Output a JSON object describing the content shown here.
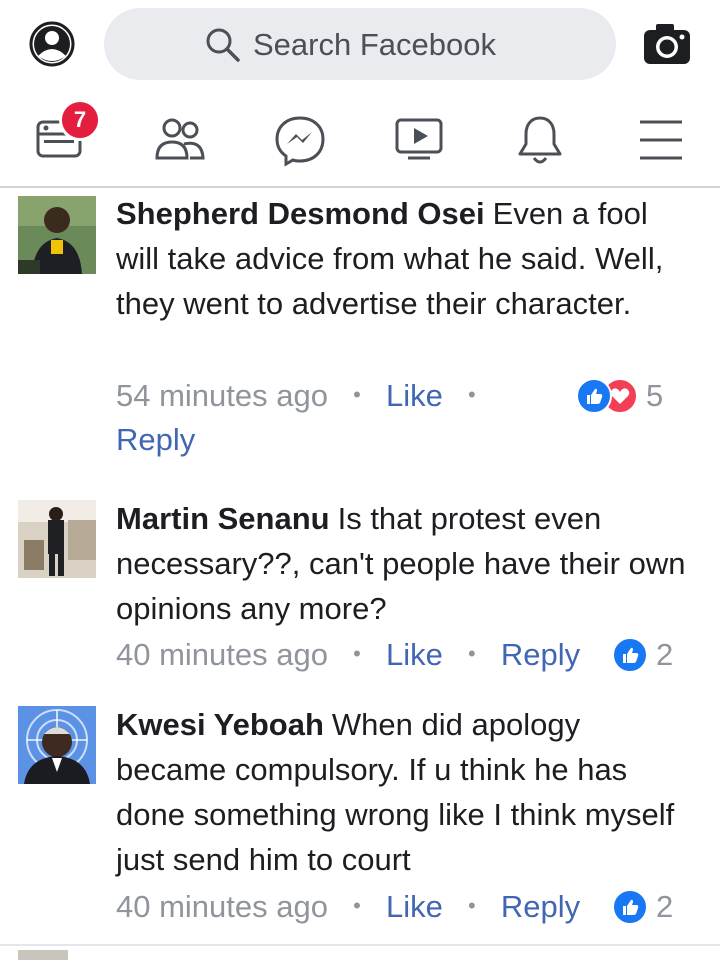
{
  "header": {
    "search_placeholder": "Search Facebook",
    "notification_count": "7"
  },
  "nav": {
    "items": [
      "news-feed-icon",
      "friends-icon",
      "messenger-icon",
      "watch-icon",
      "notifications-icon",
      "menu-icon"
    ]
  },
  "colors": {
    "link": "#4267b2",
    "badge": "#e41e3f",
    "like": "#1877f2",
    "love": "#f33e58"
  },
  "comments": [
    {
      "author": "Shepherd Desmond Osei",
      "text": "Even a fool will take advice from what he said. Well, they went to advertise their character.",
      "time": "54 minutes ago",
      "like_label": "Like",
      "reply_label": "Reply",
      "reaction_count": "5",
      "reactions": [
        "like",
        "love"
      ]
    },
    {
      "author": "Martin Senanu",
      "text": "Is that protest even necessary??, can't people have their own opinions any more?",
      "time": "40 minutes ago",
      "like_label": "Like",
      "reply_label": "Reply",
      "reaction_count": "2",
      "reactions": [
        "like"
      ]
    },
    {
      "author": "Kwesi Yeboah",
      "text": "When did apology became compulsory. If u think he has done something wrong like I think myself just send him to court",
      "time": "40 minutes ago",
      "like_label": "Like",
      "reply_label": "Reply",
      "reaction_count": "2",
      "reactions": [
        "like"
      ]
    }
  ]
}
